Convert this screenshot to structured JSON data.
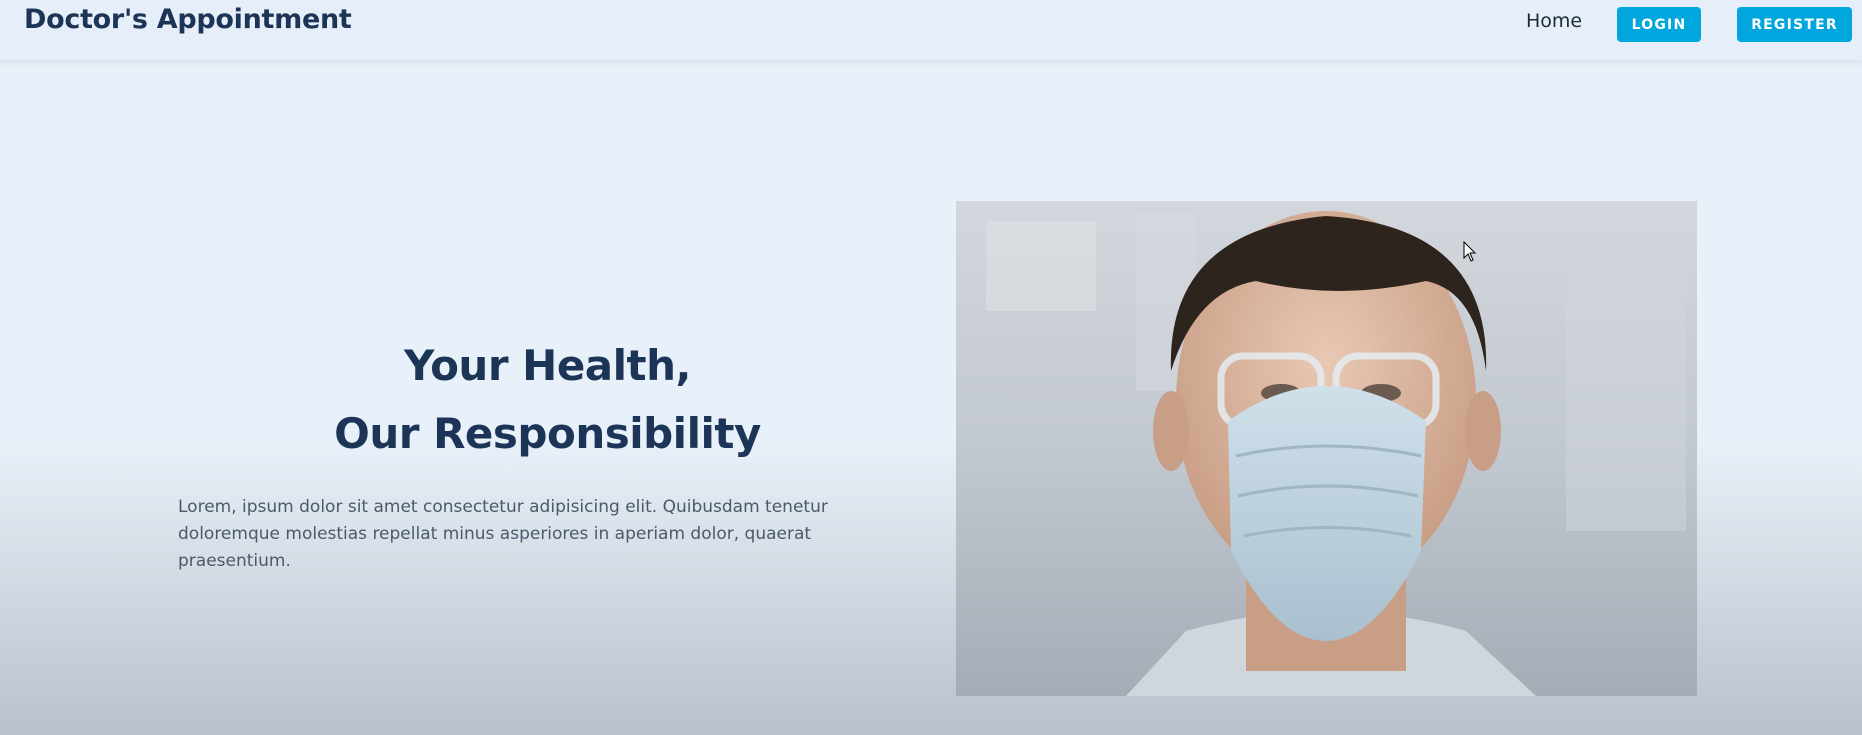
{
  "navbar": {
    "brand": "Doctor's Appointment",
    "home_link": "Home",
    "login_label": "LOGIN",
    "register_label": "REGISTER"
  },
  "hero": {
    "title_line1": "Your Health,",
    "title_line2": "Our Responsibility",
    "description": "Lorem, ipsum dolor sit amet consectetur adipisicing elit. Quibusdam tenetur doloremque molestias repellat minus asperiores in aperiam dolor, quaerat praesentium."
  },
  "image": {
    "alt": "doctor wearing surgical mask and safety glasses"
  },
  "colors": {
    "accent": "#00a6dd",
    "heading": "#1c3557",
    "background": "#e8f0f9"
  },
  "icons": {
    "cursor": "mouse-pointer-icon"
  }
}
